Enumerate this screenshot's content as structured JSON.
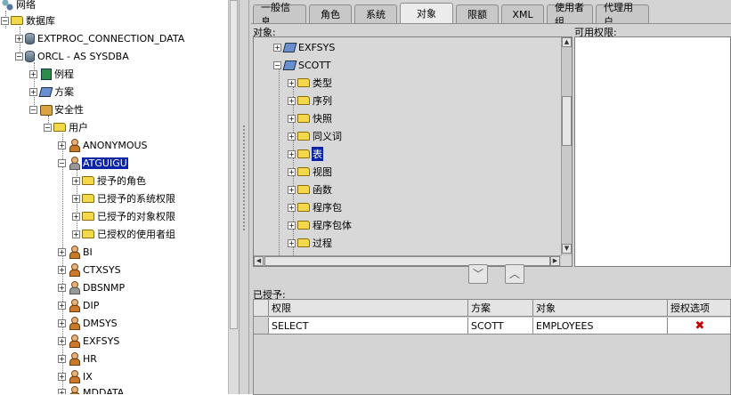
{
  "navigator": {
    "nodes": [
      {
        "label": "网络"
      },
      {
        "label": "数据库"
      },
      {
        "label": "EXTPROC_CONNECTION_DATA"
      },
      {
        "label": "ORCL - AS SYSDBA"
      },
      {
        "label": "例程"
      },
      {
        "label": "方案"
      },
      {
        "label": "安全性"
      },
      {
        "label": "用户"
      },
      {
        "label": "ANONYMOUS"
      },
      {
        "label": "ATGUIGU"
      },
      {
        "label": "授予的角色"
      },
      {
        "label": "已授予的系统权限"
      },
      {
        "label": "已授予的对象权限"
      },
      {
        "label": "已授权的使用者组"
      },
      {
        "label": "BI"
      },
      {
        "label": "CTXSYS"
      },
      {
        "label": "DBSNMP"
      },
      {
        "label": "DIP"
      },
      {
        "label": "DMSYS"
      },
      {
        "label": "EXFSYS"
      },
      {
        "label": "HR"
      },
      {
        "label": "IX"
      },
      {
        "label": "MDDATA"
      }
    ],
    "selected": "ATGUIGU"
  },
  "tabs": [
    "一般信息",
    "角色",
    "系统",
    "对象",
    "限额",
    "XML",
    "使用者组",
    "代理用户"
  ],
  "active_tab": "对象",
  "object_panel": {
    "objects_caption": "对象:",
    "available_caption": "可用权限:",
    "tree": [
      {
        "label": "EXFSYS"
      },
      {
        "label": "SCOTT"
      },
      {
        "label": "类型"
      },
      {
        "label": "序列"
      },
      {
        "label": "快照"
      },
      {
        "label": "同义词"
      },
      {
        "label": "表"
      },
      {
        "label": "视图"
      },
      {
        "label": "函数"
      },
      {
        "label": "程序包"
      },
      {
        "label": "程序包体"
      },
      {
        "label": "过程"
      }
    ],
    "tree_selected": "表",
    "move_down_icon": "chevron-down-icon",
    "move_up_icon": "chevron-up-icon"
  },
  "granted": {
    "caption": "已授予:",
    "columns": [
      "权限",
      "方案",
      "对象",
      "授权选项"
    ],
    "rows": [
      {
        "privilege": "SELECT",
        "schema": "SCOTT",
        "object": "EMPLOYEES",
        "grant_option": "✖"
      }
    ]
  },
  "colors": {
    "selection": "#0a24a8",
    "panel": "#d4d4d4",
    "revoke_mark": "#c00000"
  }
}
